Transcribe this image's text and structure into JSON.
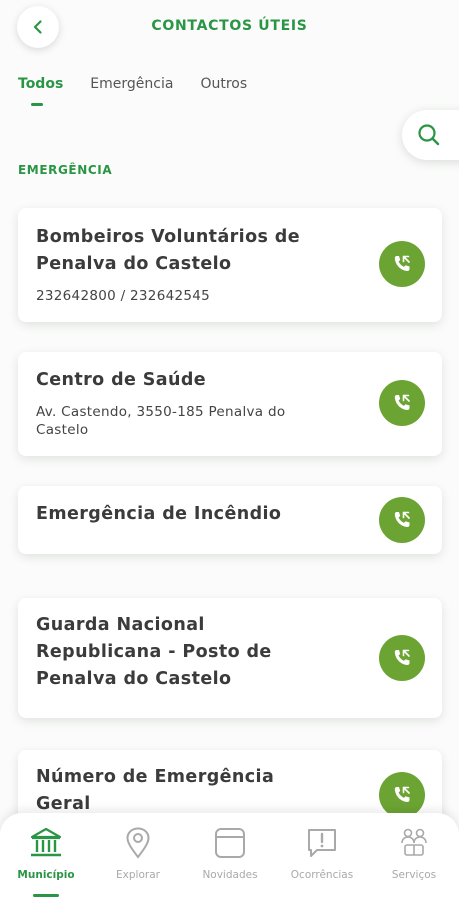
{
  "header": {
    "title": "CONTACTOS ÚTEIS"
  },
  "tabs": [
    {
      "label": "Todos"
    },
    {
      "label": "Emergência"
    },
    {
      "label": "Outros"
    }
  ],
  "section": {
    "title": "EMERGÊNCIA"
  },
  "contacts": [
    {
      "name": "Bombeiros Voluntários de Penalva do Castelo",
      "detail": "232642800 / 232642545"
    },
    {
      "name": "Centro de Saúde",
      "detail": "Av. Castendo, 3550-185 Penalva do Castelo"
    },
    {
      "name": "Emergência de Incêndio",
      "detail": ""
    },
    {
      "name": "Guarda Nacional Republicana - Posto de Penalva do Castelo",
      "detail": ""
    },
    {
      "name": "Número de Emergência Geral",
      "detail": ""
    }
  ],
  "nav": [
    {
      "label": "Município",
      "icon": "building-icon",
      "active": true
    },
    {
      "label": "Explorar",
      "icon": "map-pin-icon",
      "active": false
    },
    {
      "label": "Novidades",
      "icon": "news-icon",
      "active": false
    },
    {
      "label": "Ocorrências",
      "icon": "alert-chat-icon",
      "active": false
    },
    {
      "label": "Serviços",
      "icon": "services-icon",
      "active": false
    }
  ],
  "colors": {
    "accent": "#2a9545",
    "call_button": "#6ca434",
    "inactive": "#a9a9a9"
  }
}
